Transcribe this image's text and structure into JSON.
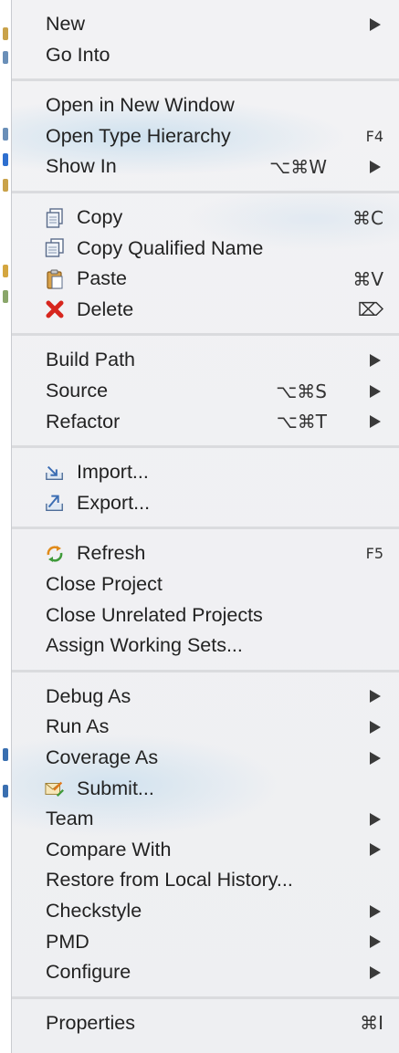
{
  "menu": {
    "groups": [
      [
        {
          "label": "New",
          "submenu": true
        },
        {
          "label": "Go Into"
        }
      ],
      [
        {
          "label": "Open in New Window"
        },
        {
          "label": "Open Type Hierarchy",
          "shortcut": "F4"
        },
        {
          "label": "Show In",
          "shortcut": "⌥⌘W",
          "submenu": true
        }
      ],
      [
        {
          "label": "Copy",
          "icon": "copy-icon",
          "shortcut": "⌘C"
        },
        {
          "label": "Copy Qualified Name",
          "icon": "copy-qualified-name-icon"
        },
        {
          "label": "Paste",
          "icon": "paste-icon",
          "shortcut": "⌘V"
        },
        {
          "label": "Delete",
          "icon": "delete-icon",
          "shortcut": "⌦"
        }
      ],
      [
        {
          "label": "Build Path",
          "submenu": true
        },
        {
          "label": "Source",
          "shortcut": "⌥⌘S",
          "submenu": true
        },
        {
          "label": "Refactor",
          "shortcut": "⌥⌘T",
          "submenu": true
        }
      ],
      [
        {
          "label": "Import...",
          "icon": "import-icon"
        },
        {
          "label": "Export...",
          "icon": "export-icon"
        }
      ],
      [
        {
          "label": "Refresh",
          "icon": "refresh-icon",
          "shortcut": "F5"
        },
        {
          "label": "Close Project"
        },
        {
          "label": "Close Unrelated Projects"
        },
        {
          "label": "Assign Working Sets..."
        }
      ],
      [
        {
          "label": "Debug As",
          "submenu": true
        },
        {
          "label": "Run As",
          "submenu": true
        },
        {
          "label": "Coverage As",
          "submenu": true
        },
        {
          "label": "Submit...",
          "icon": "submit-icon"
        },
        {
          "label": "Team",
          "submenu": true
        },
        {
          "label": "Compare With",
          "submenu": true
        },
        {
          "label": "Restore from Local History..."
        },
        {
          "label": "Checkstyle",
          "submenu": true
        },
        {
          "label": "PMD",
          "submenu": true
        },
        {
          "label": "Configure",
          "submenu": true
        }
      ],
      [
        {
          "label": "Properties",
          "shortcut": "⌘I"
        }
      ]
    ]
  },
  "colors": {
    "menu_background": "#f0f1f3",
    "separator": "#dadbde",
    "text": "#222222",
    "delete_icon": "#d7261e",
    "refresh_icon": "#e08a1a"
  }
}
